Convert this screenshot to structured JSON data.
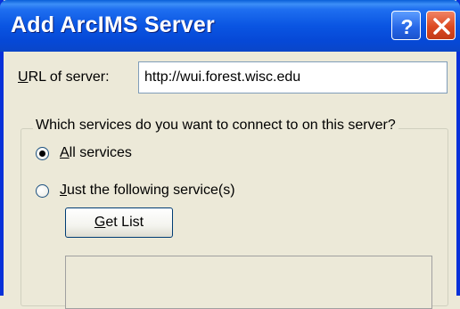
{
  "window": {
    "title": "Add ArcIMS Server",
    "help_button": "?",
    "close_button": "X"
  },
  "url": {
    "label_prefix": "U",
    "label_rest": "RL of  server:",
    "value": "http://wui.forest.wisc.edu"
  },
  "services": {
    "group_label": "Which services do you want to connect to on this server?",
    "all_option": {
      "accel": "A",
      "rest": "ll services",
      "checked": true
    },
    "just_option": {
      "accel": "J",
      "rest": "ust the following service(s)",
      "checked": false
    }
  },
  "get_list": {
    "accel": "G",
    "rest": "et List"
  },
  "colors": {
    "title_bar": "#0a55e2",
    "window_bg": "#ece9d8",
    "close_button": "#dc4a22"
  }
}
